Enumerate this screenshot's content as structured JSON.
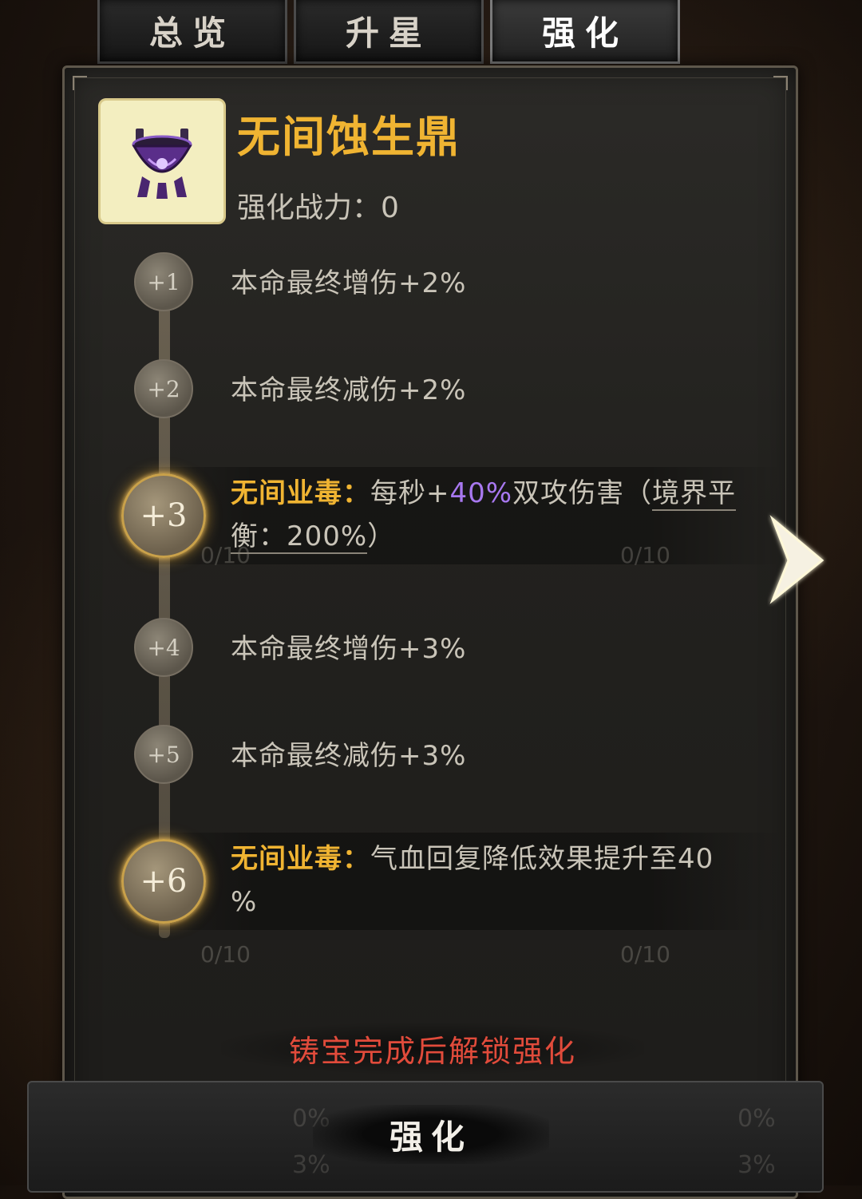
{
  "tabs": [
    {
      "label": "总览"
    },
    {
      "label": "升星"
    },
    {
      "label": "强化"
    }
  ],
  "item": {
    "name": "无间蚀生鼎",
    "power_label": "强化战力：0"
  },
  "levels": [
    {
      "node": "+1",
      "text": "本命最终增伤+2%"
    },
    {
      "node": "+2",
      "text": "本命最终减伤+2%"
    },
    {
      "node": "+3",
      "title": "无间业毒：",
      "pre": "每秒+",
      "highlight": "40%",
      "post": "双攻伤害（",
      "link1": "境界平",
      "link2": "衡：200%",
      "tail": "）"
    },
    {
      "node": "+4",
      "text": "本命最终增伤+3%"
    },
    {
      "node": "+5",
      "text": "本命最终减伤+3%"
    },
    {
      "node": "+6",
      "title": "无间业毒：",
      "line1": "气血回复降低效果提升至40",
      "line2": "%"
    }
  ],
  "counters": [
    "0/10",
    "0/10",
    "0/10",
    "0/10"
  ],
  "lock_message": "铸宝完成后解锁强化",
  "bottom_tray": {
    "ghost_left_pct_1": "0%",
    "ghost_left_pct_2": "3%",
    "ghost_right_pct_1": "0%",
    "ghost_right_pct_2": "3%"
  },
  "strengthen_button": "强化",
  "colors": {
    "gold": "#f0b432",
    "purple": "#a878f0",
    "red": "#e14b3b"
  }
}
